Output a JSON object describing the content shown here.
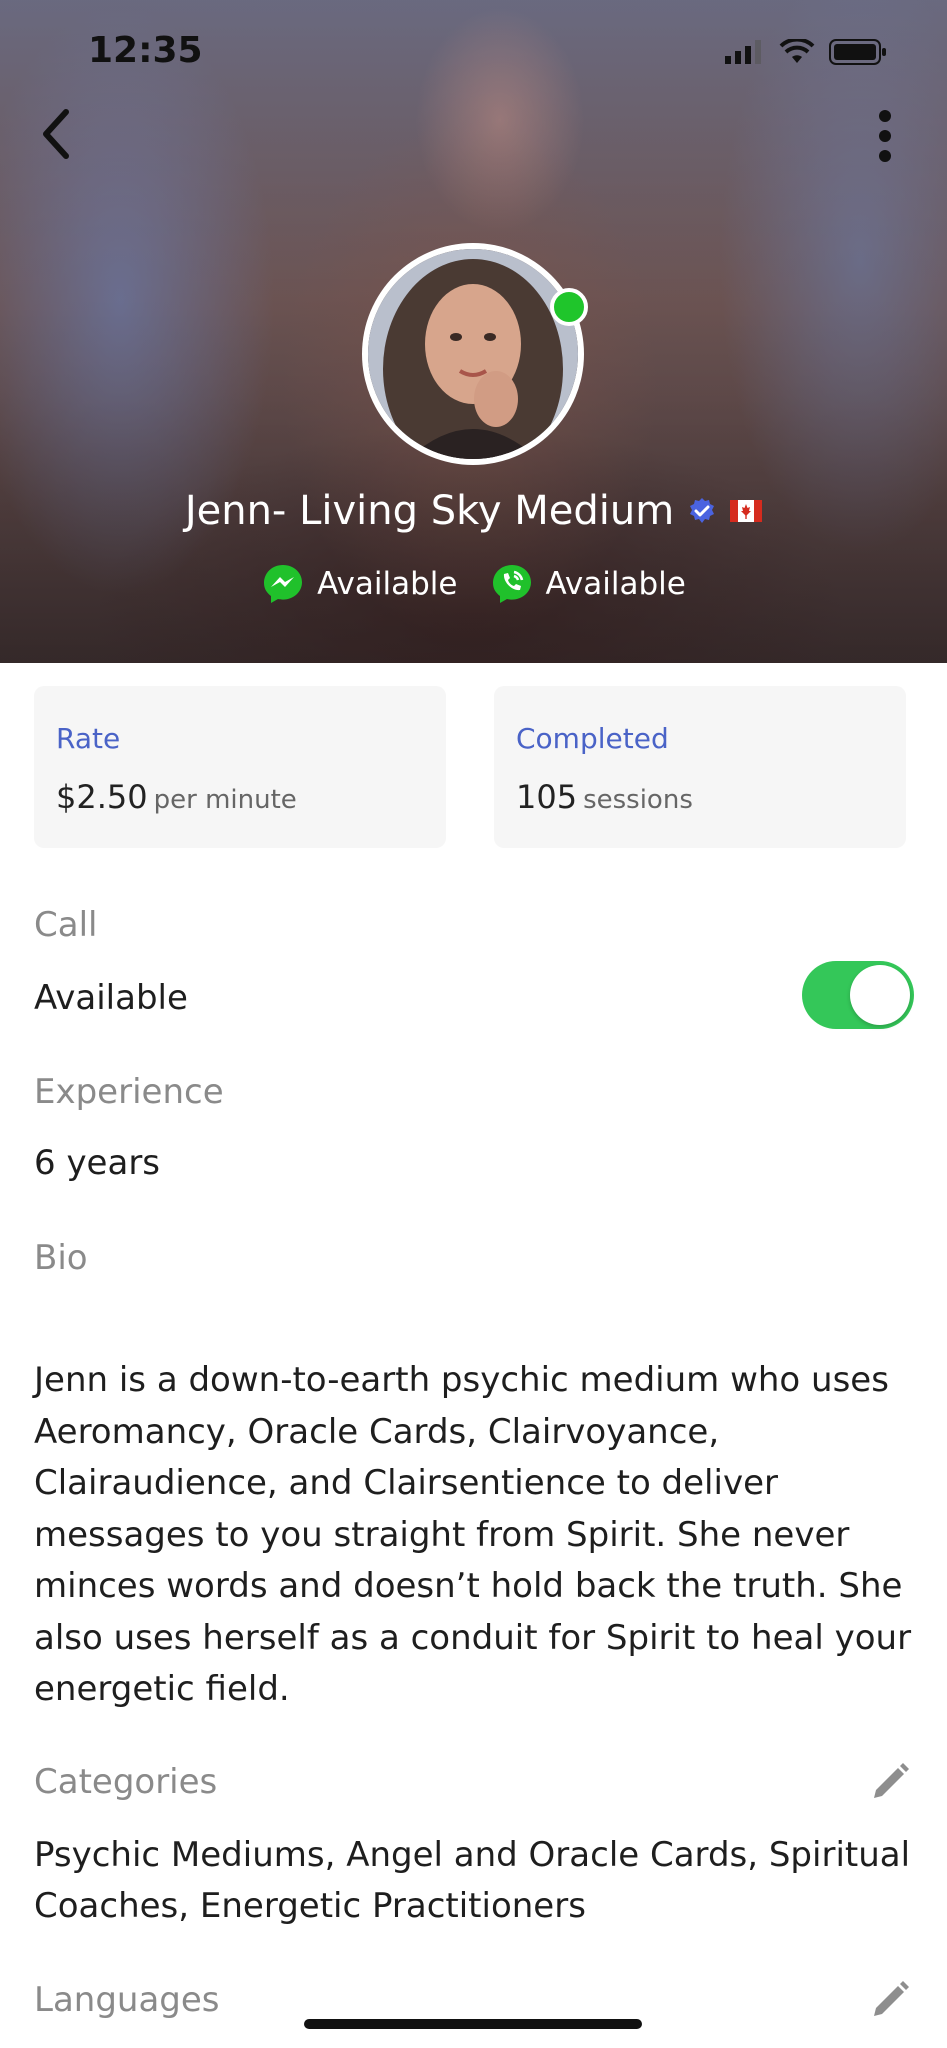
{
  "status_bar": {
    "time": "12:35"
  },
  "profile": {
    "name": "Jenn- Living Sky Medium",
    "chat_status": "Available",
    "call_status": "Available",
    "colors": {
      "online": "#1fc52b",
      "verified": "#4a63e0",
      "accent": "#4a63c7",
      "toggle_on": "#34c759"
    }
  },
  "stats": {
    "rate": {
      "label": "Rate",
      "value": "$2.50",
      "unit": "per minute"
    },
    "completed": {
      "label": "Completed",
      "value": "105",
      "unit": "sessions"
    }
  },
  "call": {
    "label": "Call",
    "value": "Available",
    "toggle_on": true
  },
  "experience": {
    "label": "Experience",
    "value": "6 years"
  },
  "bio": {
    "label": "Bio",
    "text": "Jenn is a down-to-earth psychic medium who uses Aeromancy, Oracle Cards, Clairvoyance, Clairaudience, and Clairsentience to deliver messages to you straight from Spirit. She never minces words and doesn’t hold back the truth. She also uses herself as a conduit for Spirit to heal your energetic field."
  },
  "categories": {
    "label": "Categories",
    "value": "Psychic Mediums, Angel and Oracle Cards, Spiritual Coaches, Energetic Practitioners"
  },
  "languages": {
    "label": "Languages"
  },
  "icons": {
    "back": "chevron-left-icon",
    "more": "more-vertical-icon",
    "verified": "verified-badge-icon",
    "flag": "canada-flag-icon",
    "messenger": "messenger-icon",
    "phone": "phone-call-icon",
    "edit": "pencil-icon"
  }
}
